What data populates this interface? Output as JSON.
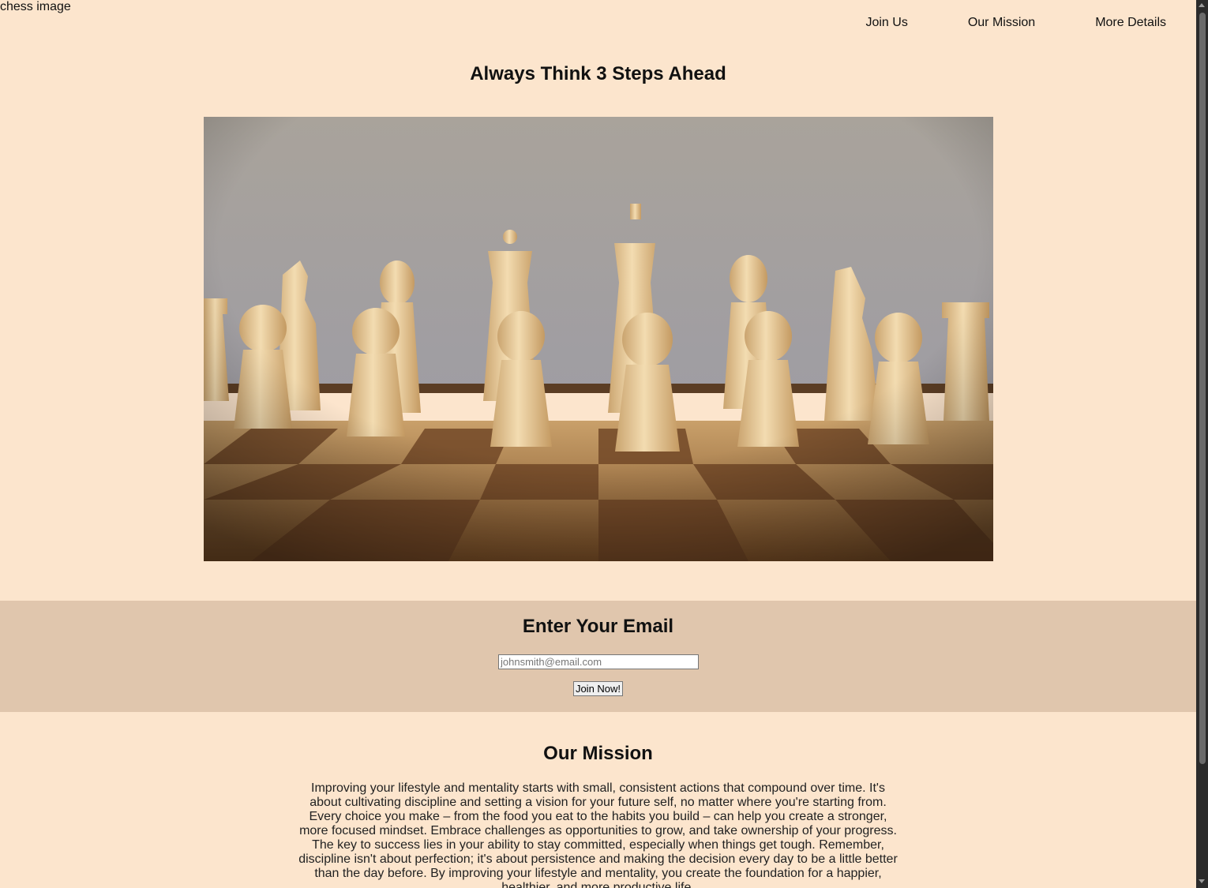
{
  "header": {
    "logo_alt": "chess image",
    "nav": [
      {
        "label": "Join Us"
      },
      {
        "label": "Our Mission"
      },
      {
        "label": "More Details"
      }
    ]
  },
  "hero": {
    "title": "Always Think 3 Steps Ahead",
    "photo_icon": "chess-board-photo"
  },
  "signup": {
    "title": "Enter Your Email",
    "placeholder": "johnsmith@email.com",
    "button_label": "Join Now!"
  },
  "mission": {
    "title": "Our Mission",
    "body": "Improving your lifestyle and mentality starts with small, consistent actions that compound over time. It's about cultivating discipline and setting a vision for your future self, no matter where you're starting from. Every choice you make – from the food you eat to the habits you build – can help you create a stronger, more focused mindset. Embrace challenges as opportunities to grow, and take ownership of your progress. The key to success lies in your ability to stay committed, especially when things get tough. Remember, discipline isn't about perfection; it's about persistence and making the decision every day to be a little better than the day before. By improving your lifestyle and mentality, you create the foundation for a happier, healthier, and more productive life."
  },
  "colors": {
    "page_background": "#fce5cd",
    "band_background": "#e0c6ad"
  }
}
